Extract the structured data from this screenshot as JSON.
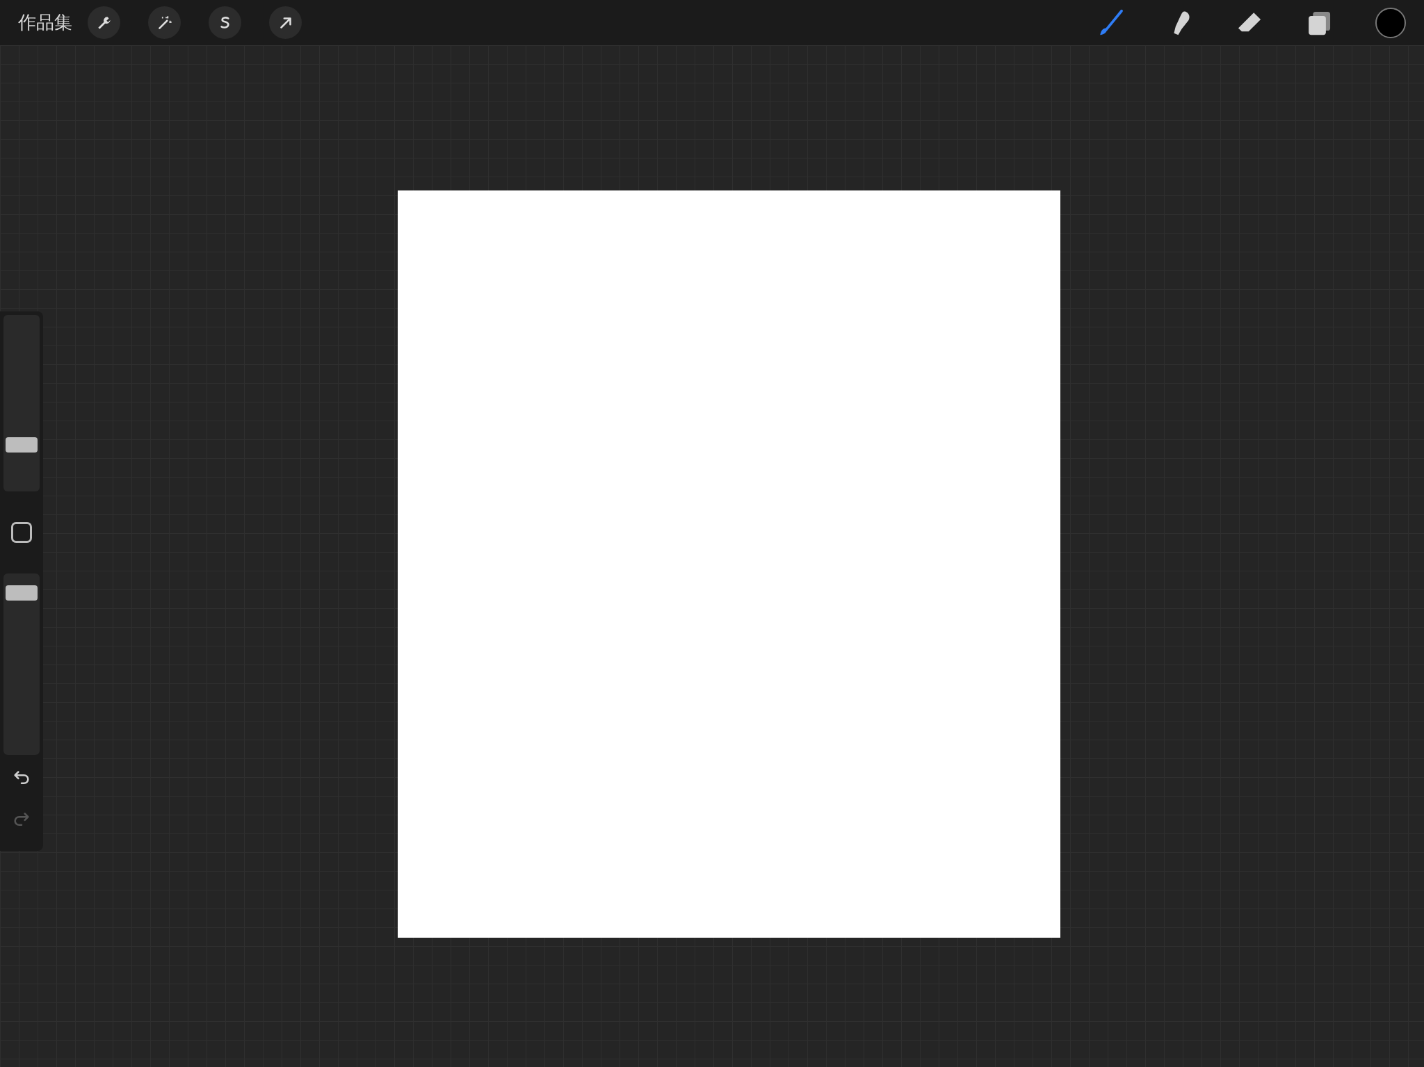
{
  "top_bar": {
    "gallery_label": "作品集",
    "actions": [
      {
        "kind": "wrench"
      },
      {
        "kind": "wand"
      },
      {
        "kind": "selection"
      },
      {
        "kind": "transform"
      }
    ],
    "tools": [
      {
        "kind": "brush",
        "selected": true
      },
      {
        "kind": "smudge",
        "selected": false
      },
      {
        "kind": "eraser",
        "selected": false
      },
      {
        "kind": "layers",
        "selected": false
      }
    ]
  },
  "sidebar": {
    "brush_size": {
      "level": 0.24
    },
    "opacity": {
      "level": 0.93
    },
    "undo": {
      "disabled": false
    },
    "redo": {
      "disabled": true
    }
  }
}
